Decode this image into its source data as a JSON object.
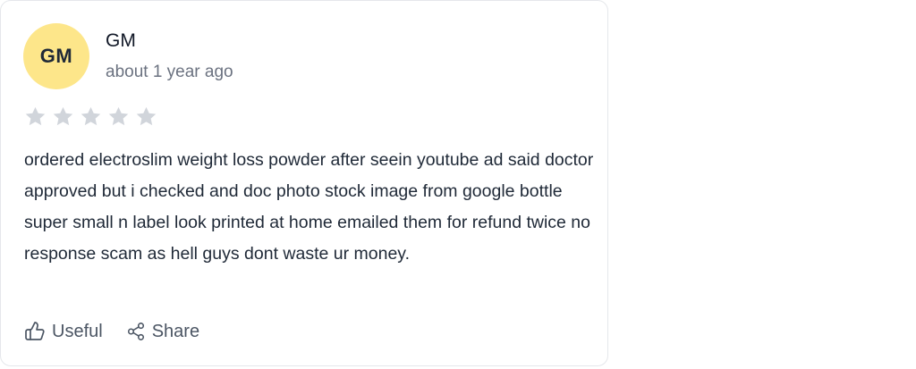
{
  "review": {
    "avatar_initials": "GM",
    "author": "GM",
    "timestamp": "about 1 year ago",
    "rating": 0,
    "max_rating": 5,
    "star_color_empty": "#d1d5db",
    "avatar_color": "#fde68a",
    "body": "ordered electroslim weight loss powder after seein youtube ad said doctor approved but i checked and doc photo stock image from google bottle super small n label look printed at home emailed them for refund twice no response scam as hell guys dont waste ur money."
  },
  "actions": {
    "useful_label": "Useful",
    "useful_icon": "thumbs-up-icon",
    "share_label": "Share",
    "share_icon": "share-icon"
  }
}
